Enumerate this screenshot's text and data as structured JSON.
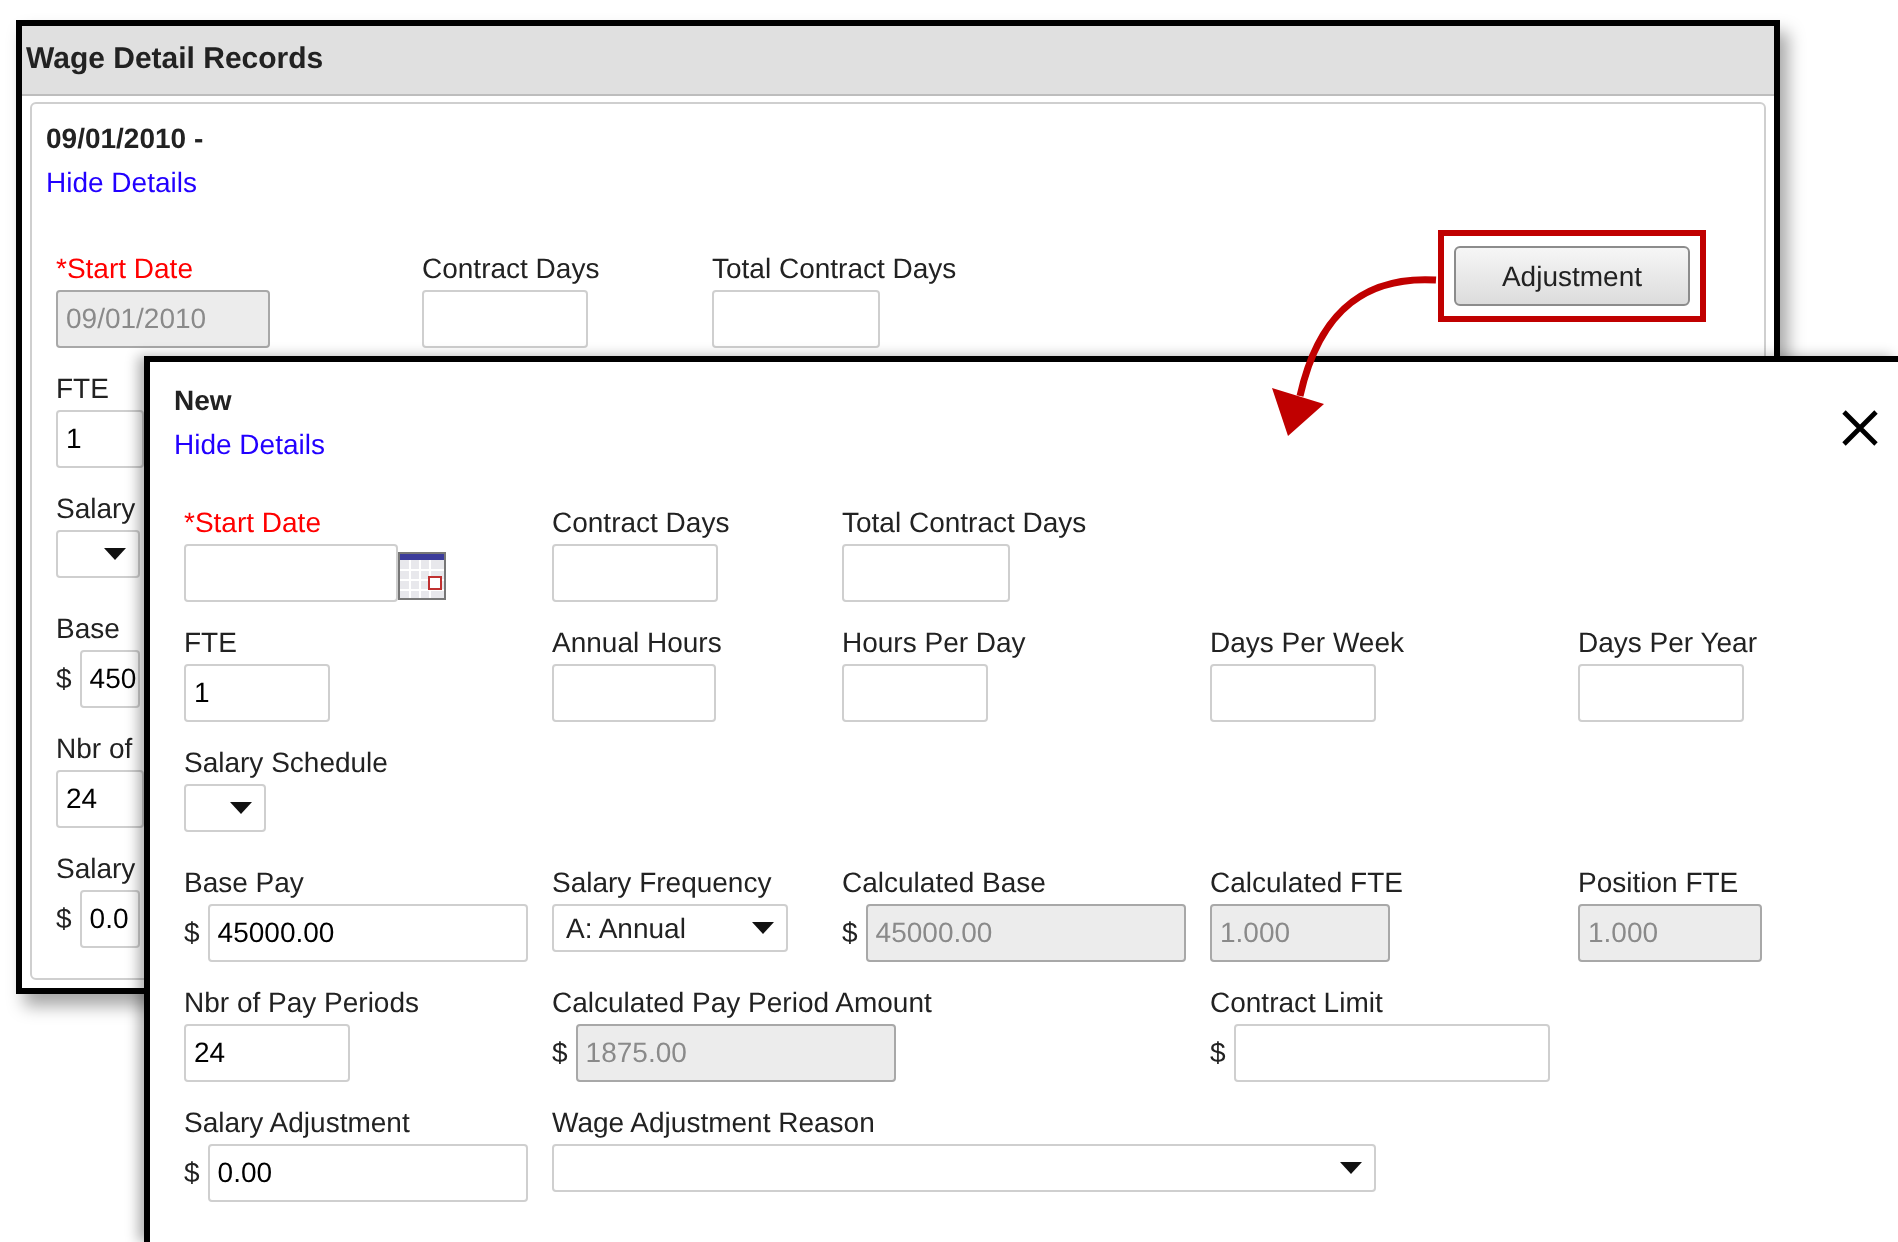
{
  "back_window": {
    "title": "Wage Detail Records",
    "record_date": "09/01/2010 -",
    "hide_details_link": "Hide Details",
    "top_fields": [
      {
        "kind": "text",
        "label": "*Start Date",
        "required": true,
        "value": "09/01/2010",
        "disabled": true
      },
      {
        "kind": "text",
        "label": "Contract Days"
      },
      {
        "kind": "text",
        "label": "Total Contract Days"
      }
    ],
    "adjustment_button": "Adjustment",
    "side_fields": [
      {
        "kind": "text",
        "label": "FTE",
        "value": "1"
      },
      {
        "kind": "select",
        "label": "Salary"
      },
      {
        "kind": "money",
        "label": "Base",
        "currency": "$",
        "value": "450"
      },
      {
        "kind": "text",
        "label": "Nbr of",
        "value": "24"
      },
      {
        "kind": "money",
        "label": "Salary",
        "currency": "$",
        "value": "0.0"
      }
    ]
  },
  "dialog": {
    "title": "New",
    "hide_details_link": "Hide Details",
    "rows": [
      [
        {
          "kind": "date",
          "label": "*Start Date",
          "required": true
        },
        {
          "kind": "text",
          "label": "Contract Days"
        },
        {
          "kind": "text",
          "label": "Total Contract Days"
        }
      ],
      [
        {
          "kind": "text",
          "label": "FTE",
          "value": "1"
        },
        {
          "kind": "text",
          "label": "Annual Hours"
        },
        {
          "kind": "text",
          "label": "Hours Per Day"
        },
        {
          "kind": "text",
          "label": "Days Per Week"
        },
        {
          "kind": "text",
          "label": "Days Per Year"
        }
      ],
      [
        {
          "kind": "select",
          "label": "Salary Schedule"
        }
      ],
      [
        {
          "kind": "money",
          "label": "Base Pay",
          "currency": "$",
          "value": "45000.00"
        },
        {
          "kind": "select",
          "label": "Salary Frequency",
          "value": "A: Annual"
        },
        {
          "kind": "money",
          "label": "Calculated Base",
          "disabled": true,
          "currency": "$",
          "value": "45000.00"
        },
        {
          "kind": "text",
          "label": "Calculated FTE",
          "disabled": true,
          "value": "1.000"
        },
        {
          "kind": "text",
          "label": "Position FTE",
          "disabled": true,
          "value": "1.000"
        }
      ],
      [
        {
          "kind": "text",
          "label": "Nbr of Pay Periods",
          "value": "24"
        },
        {
          "kind": "money",
          "label": "Calculated Pay Period Amount",
          "disabled": true,
          "currency": "$",
          "value": "1875.00"
        },
        "",
        {
          "kind": "money",
          "label": "Contract Limit",
          "currency": "$"
        }
      ],
      [
        {
          "kind": "money",
          "label": "Salary Adjustment",
          "currency": "$",
          "value": "0.00"
        },
        {
          "kind": "select",
          "label": "Wage Adjustment Reason"
        }
      ]
    ]
  }
}
